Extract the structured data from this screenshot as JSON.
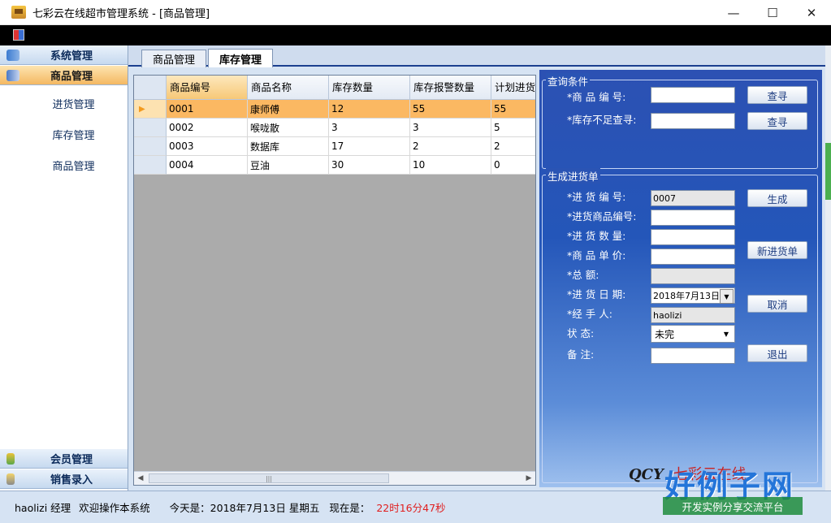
{
  "window": {
    "title": "七彩云在线超市管理系统 - [商品管理]",
    "controls": [
      "—",
      "☐",
      "✕"
    ]
  },
  "nav": {
    "sections": [
      {
        "label": "系统管理",
        "icon": "users-icon"
      },
      {
        "label": "商品管理",
        "icon": "package-icon"
      },
      {
        "label": "会员管理",
        "icon": "member-icon"
      },
      {
        "label": "销售录入",
        "icon": "sales-icon"
      }
    ],
    "sub_items": [
      "进货管理",
      "库存管理",
      "商品管理"
    ]
  },
  "tabs": [
    "商品管理",
    "库存管理"
  ],
  "grid": {
    "headers": [
      "商品编号",
      "商品名称",
      "库存数量",
      "库存报警数量",
      "计划进货"
    ],
    "rows": [
      {
        "id": "0001",
        "name": "康师傅",
        "stock": "12",
        "alarm": "55",
        "plan": "55",
        "selected": true
      },
      {
        "id": "0002",
        "name": "喉咙散",
        "stock": "3",
        "alarm": "3",
        "plan": "5"
      },
      {
        "id": "0003",
        "name": "数据库",
        "stock": "17",
        "alarm": "2",
        "plan": "2"
      },
      {
        "id": "0004",
        "name": "豆油",
        "stock": "30",
        "alarm": "10",
        "plan": "0"
      }
    ],
    "scroll_grip": "|||"
  },
  "query": {
    "legend": "查询条件",
    "label_code": "*商 品 编 号:",
    "label_short": "*库存不足查寻:",
    "btn1": "查寻",
    "btn2": "查寻"
  },
  "purchase": {
    "legend": "生成进货单",
    "labels": {
      "order_no": "*进 货 编 号:",
      "product_no": "*进货商品编号:",
      "qty": "*进 货 数 量:",
      "price": "*商 品 单 价:",
      "total": "*总   额:",
      "date": "*进 货 日 期:",
      "handler": "*经 手 人:",
      "status": "状   态:",
      "note": "备   注:"
    },
    "values": {
      "order_no": "0007",
      "date": "2018年7月13日",
      "handler": "haolizi",
      "status": "未完"
    },
    "buttons": {
      "generate": "生成",
      "new_order": "新进货单",
      "cancel": "取消",
      "exit": "退出"
    }
  },
  "logo": {
    "abbr": "QCY",
    "name": "七彩云在线"
  },
  "status": {
    "user": "haolizi 经理",
    "welcome": "欢迎操作本系统",
    "today": "今天是：2018年7月13日 星期五",
    "now_label": "现在是：",
    "time": "22时16分47秒"
  },
  "watermark": {
    "brand": "好例子网",
    "tagline": "开发实例分享交流平台"
  },
  "colors": {
    "accent": "#2456b9",
    "selected_row": "#fbb862",
    "clock": "#e02020"
  }
}
